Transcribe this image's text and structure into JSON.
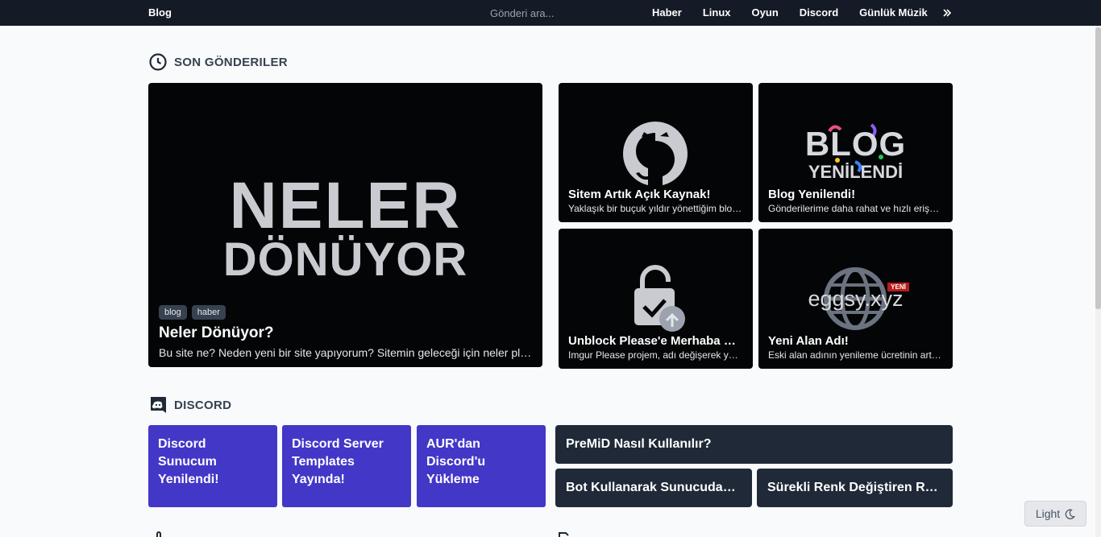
{
  "header": {
    "brand": "Blog",
    "search_placeholder": "Gönderi ara...",
    "nav": [
      "Haber",
      "Linux",
      "Oyun",
      "Discord",
      "Günlük Müzik"
    ],
    "more_icon": "chevrons-right-icon"
  },
  "recent": {
    "section_title": "SON GÖNDERILER",
    "featured": {
      "image_line1": "NELER",
      "image_line2": "DÖNÜYOR",
      "tags": [
        "blog",
        "haber"
      ],
      "title": "Neler Dönüyor?",
      "desc": "Bu site ne? Neden yeni bir site yapıyorum? Sitemin geleceği için neler planlıyorum?"
    },
    "posts": [
      {
        "title": "Sitem Artık Açık Kaynak!",
        "desc": "Yaklaşık bir buçuk yıldır yönettiğim blog sitemin kaynak kodları",
        "icon": "github-icon"
      },
      {
        "title": "Blog Yenilendi!",
        "desc": "Gönderilerime daha rahat ve hızlı erişebilmeniz için",
        "image_line1": "BLOG",
        "image_line2": "YENİLENDİ"
      },
      {
        "title": "Unblock Please'e Merhaba Deyin!",
        "desc": "Imgur Please projem, adı değişerek yeniden",
        "icon": "unlock-icon"
      },
      {
        "title": "Yeni Alan Adı!",
        "desc": "Eski alan adının yenileme ücretinin artması",
        "image_text": "eggsy.xyz",
        "badge": "YENİ"
      }
    ]
  },
  "discord": {
    "section_title": "DISCORD",
    "cards": [
      "Discord Sunucum Yenilendi!",
      "Discord Server Templates Yayında!",
      "AUR'dan Discord'u Yükleme"
    ],
    "dark_cards": [
      "PreMiD Nasıl Kullanılır?",
      "Bot Kullanarak Sunucudaki Kanalları Yönetme",
      "Sürekli Renk Değiştiren Rol Yapımı"
    ]
  },
  "theme_toggle": {
    "label": "Light",
    "icon": "moon-icon"
  },
  "colors": {
    "nav_bg": "#141a26",
    "discord_purple": "#4337c8",
    "dark_card": "#1f2937",
    "page_bg": "#f9fafb"
  }
}
